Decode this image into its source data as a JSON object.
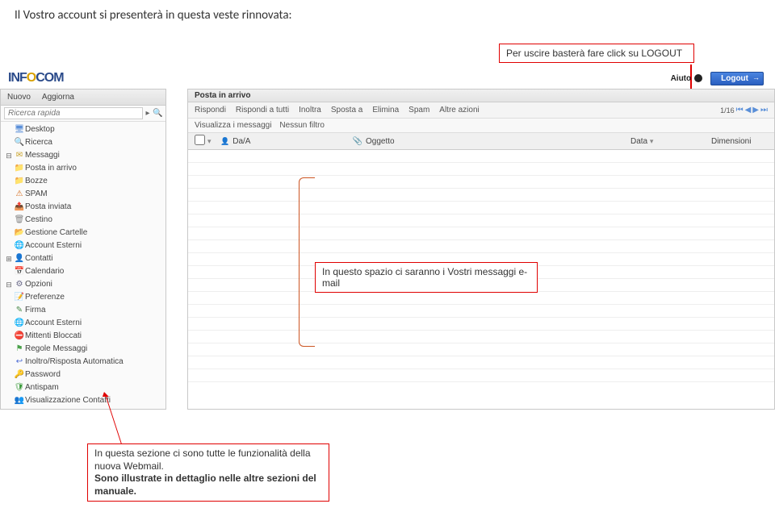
{
  "intro": "Il Vostro account si presenterà in questa veste rinnovata:",
  "callouts": {
    "logout": "Per uscire basterà fare click su LOGOUT",
    "messages": "In questo spazio ci saranno i Vostri messaggi e-mail",
    "bottom_l1": "In questa sezione ci sono tutte le funzionalità della nuova Webmail.",
    "bottom_l2": "Sono illustrate in dettaglio nelle altre sezioni del manuale."
  },
  "top": {
    "logo_a": "INF",
    "logo_o": "O",
    "logo_b": "COM",
    "aiuto": "Aiuto",
    "logout": "Logout"
  },
  "sidebar": {
    "nuovo": "Nuovo",
    "aggiorna": "Aggiorna",
    "search_placeholder": "Ricerca rapida",
    "items": {
      "desktop": "Desktop",
      "ricerca": "Ricerca",
      "messaggi": "Messaggi",
      "posta_arrivo": "Posta in arrivo",
      "bozze": "Bozze",
      "spam": "SPAM",
      "posta_inviata": "Posta inviata",
      "cestino": "Cestino",
      "gestione": "Gestione Cartelle",
      "esterni": "Account Esterni",
      "contatti": "Contatti",
      "calendario": "Calendario",
      "opzioni": "Opzioni",
      "preferenze": "Preferenze",
      "firma": "Firma",
      "acc_esterni2": "Account Esterni",
      "mittenti": "Mittenti Bloccati",
      "regole": "Regole Messaggi",
      "inoltro": "Inoltro/Risposta Automatica",
      "password": "Password",
      "antispam": "Antispam",
      "vis_contatti": "Visualizzazione Contatti"
    }
  },
  "inbox": {
    "title": "Posta in arrivo",
    "toolbar": {
      "rispondi": "Rispondi",
      "rispondi_tutti": "Rispondi a tutti",
      "inoltra": "Inoltra",
      "sposta": "Sposta a",
      "elimina": "Elimina",
      "spam": "Spam",
      "altre": "Altre azioni",
      "pager": "1/16"
    },
    "subtool": {
      "visualizza": "Visualizza i messaggi",
      "filtro": "Nessun filtro"
    },
    "cols": {
      "da": "Da/A",
      "oggetto": "Oggetto",
      "data": "Data",
      "dim": "Dimensioni"
    }
  }
}
